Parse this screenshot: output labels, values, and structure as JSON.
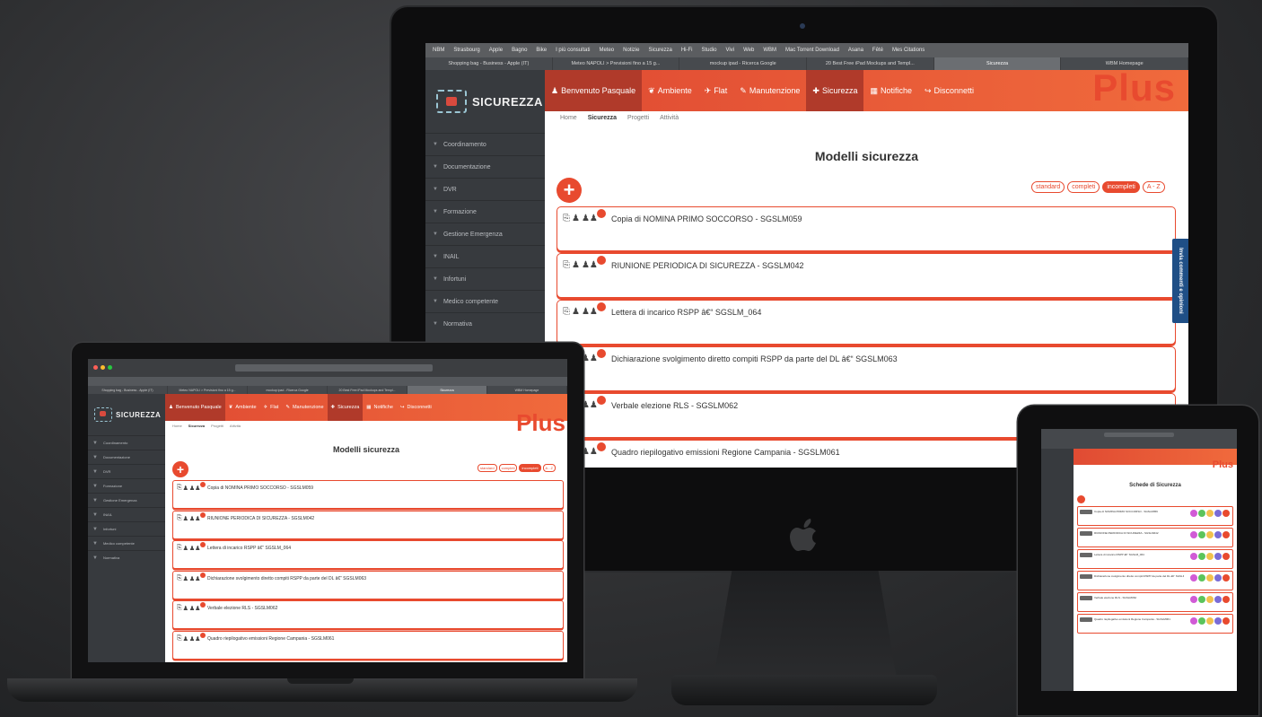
{
  "app": {
    "logo_text": "SICUREZZA",
    "brand": "Plus",
    "page_title": "Modelli sicurezza",
    "tablet_page_title": "Schede di Sicurezza",
    "feedback_tab": "Invia commenti e opinioni"
  },
  "bookmarks": [
    "NBM",
    "Strasbourg",
    "Apple",
    "Bagno",
    "Bike",
    "I più consultati",
    "Meteo",
    "Notizie",
    "Sicurezza",
    "Hi-Fi",
    "Studio",
    "Vivi",
    "Web",
    "WBM",
    "Mac Torrent Download",
    "Asana",
    "Fêté",
    "Mes Citations"
  ],
  "tabs": [
    {
      "label": "Shopping bag - Business - Apple (IT)",
      "active": false
    },
    {
      "label": "Meteo NAPOLI > Previsioni fino a 15 g...",
      "active": false
    },
    {
      "label": "mockup ipad - Ricerca Google",
      "active": false
    },
    {
      "label": "20 Best Free iPad Mockups and Templ...",
      "active": false
    },
    {
      "label": "Sicurezza",
      "active": true
    },
    {
      "label": "WBM Homepage",
      "active": false
    }
  ],
  "nav": [
    {
      "label": "Benvenuto Pasquale",
      "icon": "user-icon",
      "glyph": "♟",
      "active": true
    },
    {
      "label": "Ambiente",
      "icon": "leaf-icon",
      "glyph": "❦",
      "active": false
    },
    {
      "label": "Flat",
      "icon": "plane-icon",
      "glyph": "✈",
      "active": false
    },
    {
      "label": "Manutenzione",
      "icon": "wrench-icon",
      "glyph": "✎",
      "active": false
    },
    {
      "label": "Sicurezza",
      "icon": "medkit-icon",
      "glyph": "✚",
      "active": true
    },
    {
      "label": "Notifiche",
      "icon": "chart-icon",
      "glyph": "▦",
      "active": false
    },
    {
      "label": "Disconnetti",
      "icon": "share-icon",
      "glyph": "↪",
      "active": false
    }
  ],
  "breadcrumb": [
    {
      "label": "Home",
      "bold": false
    },
    {
      "label": "Sicurezza",
      "bold": true
    },
    {
      "label": "Progetti",
      "bold": false
    },
    {
      "label": "Attività",
      "bold": false
    }
  ],
  "sidebar": [
    "Coordinamento",
    "Documentazione",
    "DVR",
    "Formazione",
    "Gestione Emergenza",
    "INAIL",
    "Infortuni",
    "Medico competente",
    "Normativa"
  ],
  "filters": [
    {
      "label": "standard",
      "on": false
    },
    {
      "label": "completi",
      "on": false
    },
    {
      "label": "incompleti",
      "on": true
    },
    {
      "label": "A - Z",
      "on": false
    }
  ],
  "models": [
    "Copia di NOMINA PRIMO SOCCORSO - SGSLM059",
    "RIUNIONE PERIODICA DI SICUREZZA - SGSLM042",
    "Lettera di incarico RSPP â€“ SGSLM_064",
    "Dichiarazione svolgimento diretto compiti RSPP da parte del DL â€“ SGSLM063",
    "Verbale elezione RLS - SGSLM062",
    "Quadro riepilogativo emissioni Regione Campania - SGSLM061"
  ],
  "colors": {
    "accent": "#e84a2f",
    "sidebar": "#373a3e",
    "nav_active": "#b03a2a"
  }
}
